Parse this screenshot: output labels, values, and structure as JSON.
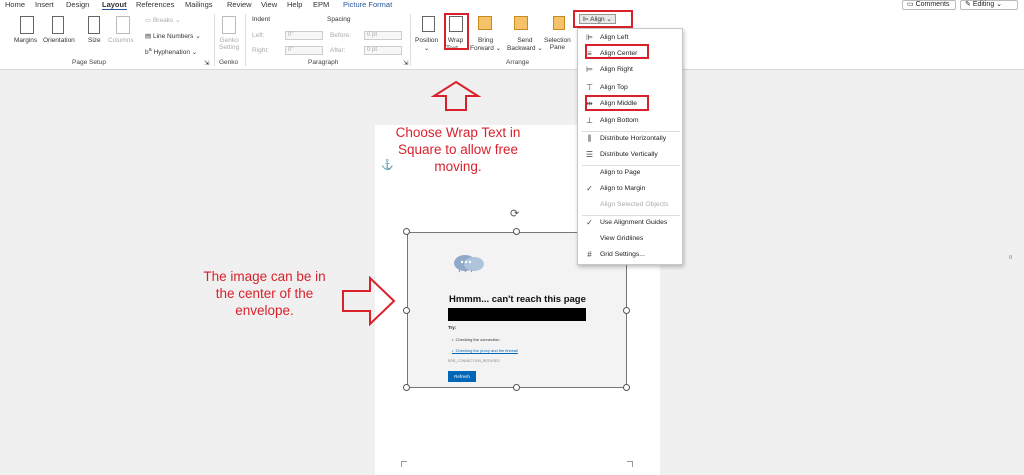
{
  "menu": {
    "tabs": [
      "Home",
      "Insert",
      "Design",
      "Layout",
      "References",
      "Mailings",
      "Review",
      "View",
      "Help",
      "EPM",
      "Picture Format"
    ],
    "comments": "Comments",
    "editing": "Editing"
  },
  "ribbon": {
    "margins": "Margins",
    "orientation": "Orientation",
    "size": "Size",
    "columns": "Columns",
    "breaks": "Breaks",
    "line_numbers": "Line Numbers",
    "hyphenation": "Hyphenation",
    "page_setup": "Page Setup",
    "genko_setting_1": "Genko",
    "genko_setting_2": "Setting",
    "genko": "Genko",
    "indent": "Indent",
    "spacing": "Spacing",
    "left": "Left:",
    "right": "Right:",
    "before": "Before:",
    "after": "After:",
    "left_val": "0\"",
    "right_val": "0\"",
    "before_val": "0 pt",
    "after_val": "0 pt",
    "paragraph": "Paragraph",
    "position": "Position",
    "wrap_1": "Wrap",
    "wrap_2": "Text",
    "bring_1": "Bring",
    "bring_2": "Forward",
    "send_1": "Send",
    "send_2": "Backward",
    "selection_1": "Selection",
    "selection_2": "Pane",
    "arrange": "Arrange",
    "align": "Align"
  },
  "annotations": {
    "wrap_note": "Choose Wrap Text in Square to allow free moving.",
    "center_note": "The image can be in the center of the envelope."
  },
  "picture": {
    "heading": "Hmmm... can't reach this page",
    "try": "Try:",
    "bullet_1": "Checking the connection",
    "bullet_2": "Checking the proxy and the firewall",
    "error_code": "ERR_CONNECTION_REFUSED",
    "refresh": "Refresh"
  },
  "align_menu": {
    "items": [
      {
        "label": "Align Left",
        "icon": "align-left-icon"
      },
      {
        "label": "Align Center",
        "icon": "align-center-icon"
      },
      {
        "label": "Align Right",
        "icon": "align-right-icon"
      },
      {
        "label": "Align Top",
        "icon": "align-top-icon"
      },
      {
        "label": "Align Middle",
        "icon": "align-middle-icon"
      },
      {
        "label": "Align Bottom",
        "icon": "align-bottom-icon"
      },
      {
        "label": "Distribute Horizontally",
        "icon": "distribute-horizontal-icon"
      },
      {
        "label": "Distribute Vertically",
        "icon": "distribute-vertical-icon"
      },
      {
        "label": "Align to Page",
        "icon": ""
      },
      {
        "label": "Align to Margin",
        "icon": "checkmark-icon"
      },
      {
        "label": "Align Selected Objects",
        "icon": ""
      },
      {
        "label": "Use Alignment Guides",
        "icon": "checkmark-icon"
      },
      {
        "label": "View Gridlines",
        "icon": ""
      },
      {
        "label": "Grid Settings...",
        "icon": "grid-icon"
      }
    ]
  },
  "colors": {
    "highlight": "#d9212c",
    "accent": "#2b579a",
    "refresh_button": "#0067b8"
  }
}
